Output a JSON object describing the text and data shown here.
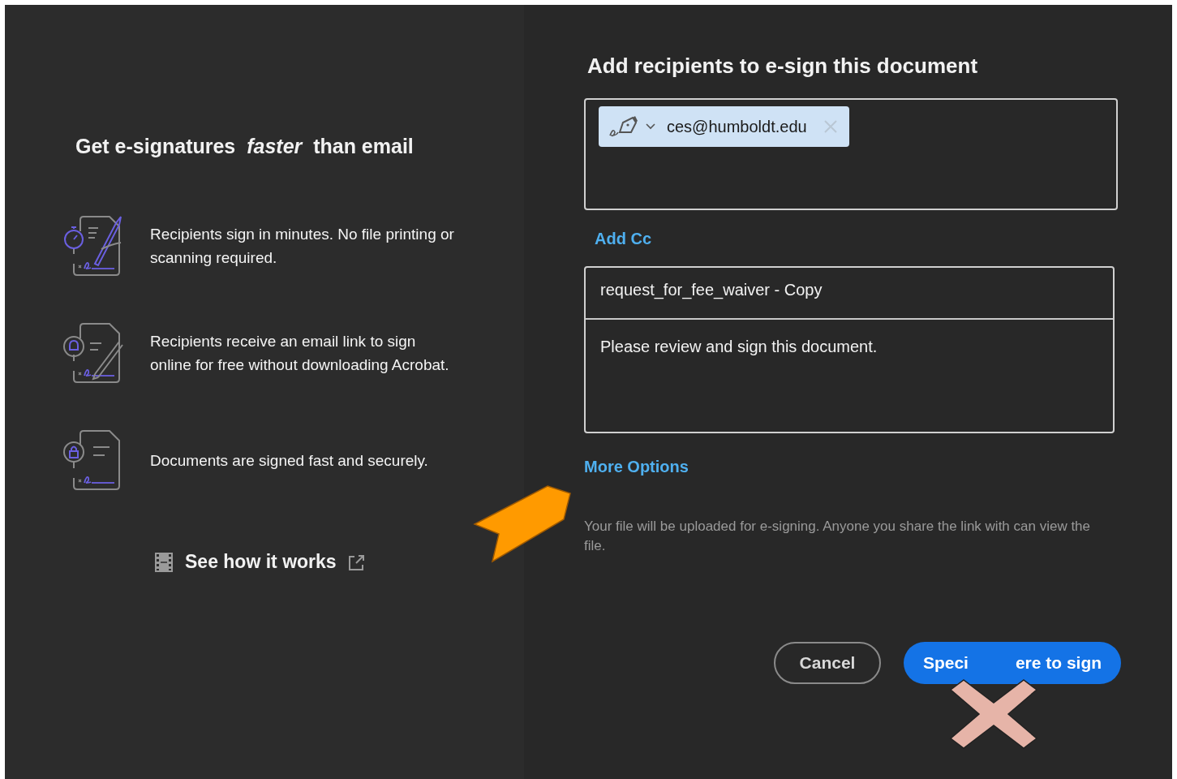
{
  "promo": {
    "heading": "Get e-signatures  *faster*  than email",
    "features": [
      {
        "kind": "stopwatch",
        "text": "Recipients sign in minutes. No file printing or scanning required."
      },
      {
        "kind": "bell",
        "text": "Recipients receive an email link to sign online for free without downloading Acrobat."
      },
      {
        "kind": "lock",
        "text": "Documents are signed fast and securely."
      }
    ],
    "video_link": "See how it works"
  },
  "form": {
    "title": "Add recipients to e-sign this document",
    "recipients": [
      {
        "email": "ces@humboldt.edu"
      }
    ],
    "add_cc": "Add Cc",
    "subject": "request_for_fee_waiver - Copy",
    "message": "Please review and sign this document.",
    "more_options": "More Options",
    "notice": "Your file will be uploaded for e-signing. Anyone you share the link with can view the file.",
    "buttons": [
      {
        "kind": "secondary",
        "label": "Cancel"
      },
      {
        "kind": "primary",
        "label_parts": [
          "Speci",
          "ere to sign"
        ]
      }
    ]
  },
  "annotations": [
    {
      "kind": "arrow"
    },
    {
      "kind": "cross"
    }
  ]
}
